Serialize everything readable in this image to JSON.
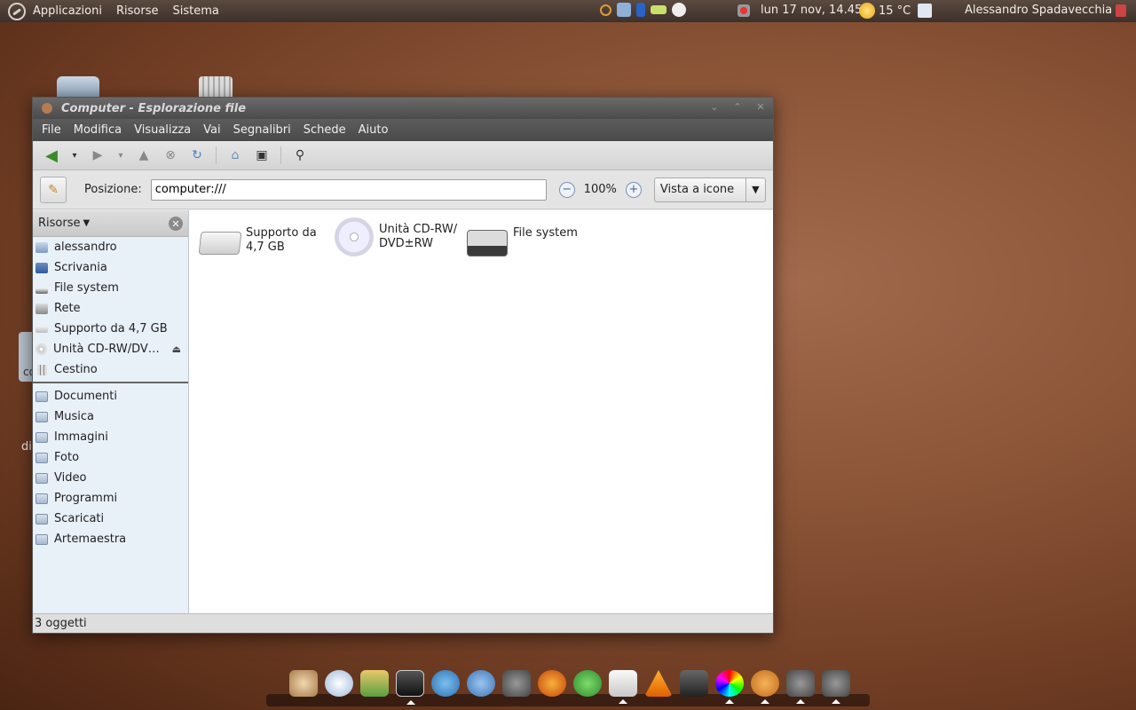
{
  "top_panel": {
    "menus": [
      "Applicazioni",
      "Risorse",
      "Sistema"
    ],
    "clock": "lun 17 nov, 14.45",
    "weather": "15 °C",
    "user": "Alessandro Spadavecchia"
  },
  "window": {
    "title": "Computer - Esplorazione file",
    "menu": [
      "File",
      "Modifica",
      "Visualizza",
      "Vai",
      "Segnalibri",
      "Schede",
      "Aiuto"
    ],
    "location_label": "Posizione:",
    "location_value": "computer:///",
    "zoom": "100%",
    "view_mode": "Vista a icone",
    "sidebar": {
      "header": "Risorse",
      "places": [
        {
          "label": "alessandro",
          "icon": "home-folder-icon"
        },
        {
          "label": "Scrivania",
          "icon": "desktop-icon"
        },
        {
          "label": "File system",
          "icon": "filesystem-icon"
        },
        {
          "label": "Rete",
          "icon": "network-icon"
        },
        {
          "label": "Supporto da 4,7 GB",
          "icon": "drive-icon"
        },
        {
          "label": "Unità CD-RW/DV…",
          "icon": "cd-icon"
        },
        {
          "label": "Cestino",
          "icon": "trash-icon"
        }
      ],
      "bookmarks": [
        "Documenti",
        "Musica",
        "Immagini",
        "Foto",
        "Video",
        "Programmi",
        "Scaricati",
        "Artemaestra"
      ]
    },
    "items": [
      {
        "label_line1": "Supporto da",
        "label_line2": "4,7 GB",
        "icon": "drive-icon"
      },
      {
        "label_line1": "Unità CD-RW/",
        "label_line2": "DVD±RW",
        "icon": "cd-icon"
      },
      {
        "label_line1": "File system",
        "label_line2": "",
        "icon": "filesystem-icon"
      }
    ],
    "status": "3 oggetti"
  },
  "desktop": {
    "fragment_1": "co",
    "fragment_2": "di"
  },
  "colors": {
    "panel": "#3d302a",
    "window_titlebar": "#4b4b4b",
    "sidebar_bg": "#e8f0f8",
    "desktop": "#8c5538"
  }
}
